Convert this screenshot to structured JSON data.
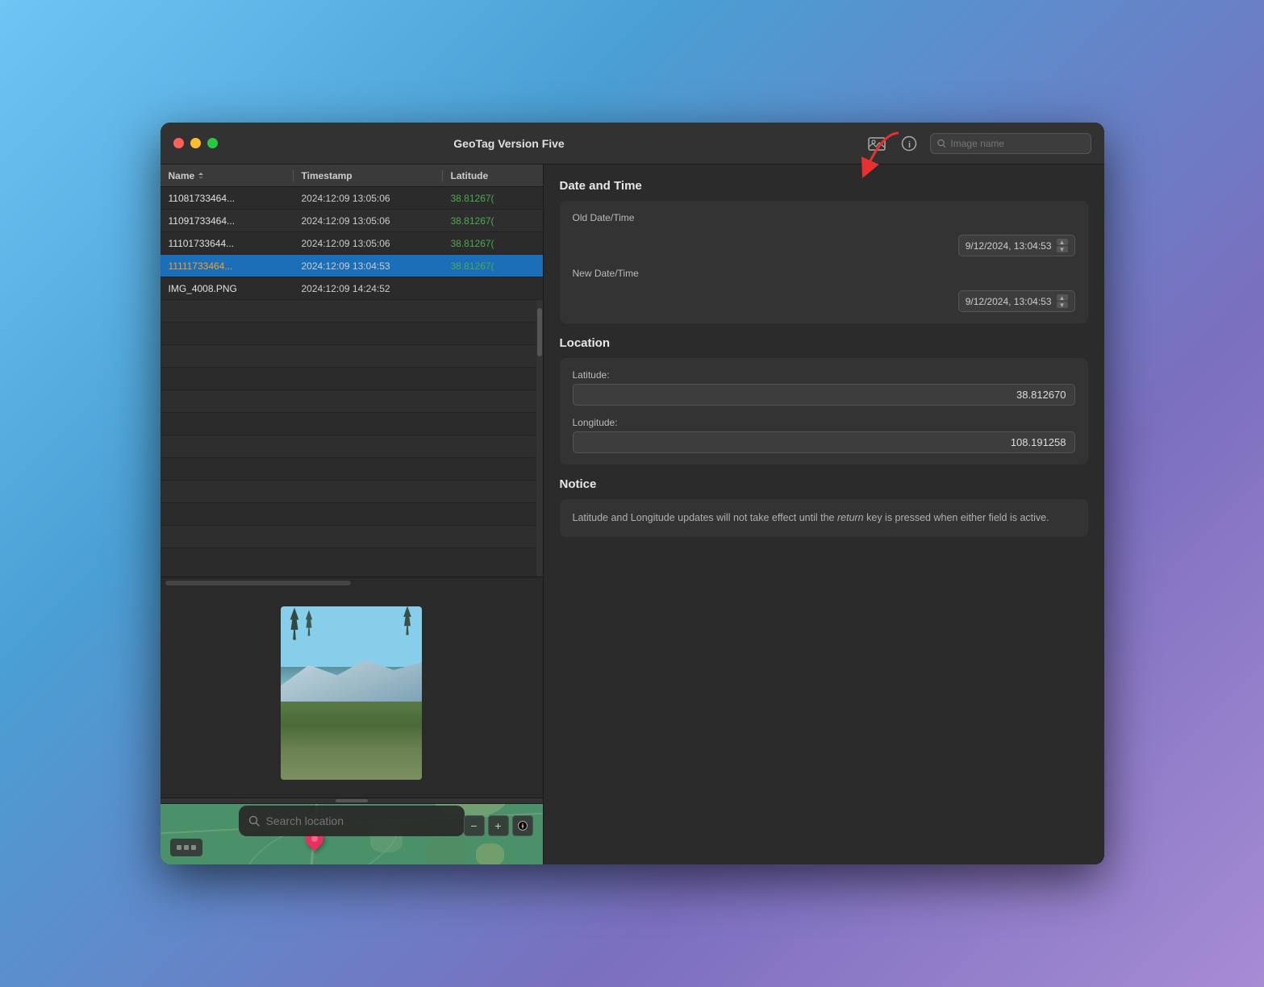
{
  "window": {
    "title": "GeoTag Version Five"
  },
  "titlebar": {
    "search_placeholder": "Image name"
  },
  "table": {
    "headers": {
      "name": "Name",
      "timestamp": "Timestamp",
      "latitude": "Latitude"
    },
    "rows": [
      {
        "name": "11081733464...",
        "timestamp": "2024:12:09 13:05:06",
        "latitude": "38.81267(",
        "selected": false
      },
      {
        "name": "11091733464...",
        "timestamp": "2024:12:09 13:05:06",
        "latitude": "38.81267(",
        "selected": false
      },
      {
        "name": "11101733644...",
        "timestamp": "2024:12:09 13:05:06",
        "latitude": "38.81267(",
        "selected": false
      },
      {
        "name": "11111733464...",
        "timestamp": "2024:12:09 13:04:53",
        "latitude": "38.81267(",
        "selected": true
      },
      {
        "name": "IMG_4008.PNG",
        "timestamp": "2024:12:09 14:24:52",
        "latitude": "",
        "selected": false
      }
    ]
  },
  "right_panel": {
    "date_time_section": "Date and Time",
    "old_date_label": "Old Date/Time",
    "old_date_value": "9/12/2024, 13:04:53",
    "new_date_label": "New Date/Time",
    "new_date_value": "9/12/2024, 13:04:53",
    "location_section": "Location",
    "latitude_label": "Latitude:",
    "latitude_value": "38.812670",
    "longitude_label": "Longitude:",
    "longitude_value": "108.191258",
    "notice_section": "Notice",
    "notice_text": "Latitude and Longitude updates will not take effect until the ",
    "notice_italic": "return",
    "notice_text2": " key is pressed when either field is active."
  },
  "map": {
    "search_placeholder": "Search location",
    "zoom_minus": "−",
    "zoom_plus": "+"
  }
}
